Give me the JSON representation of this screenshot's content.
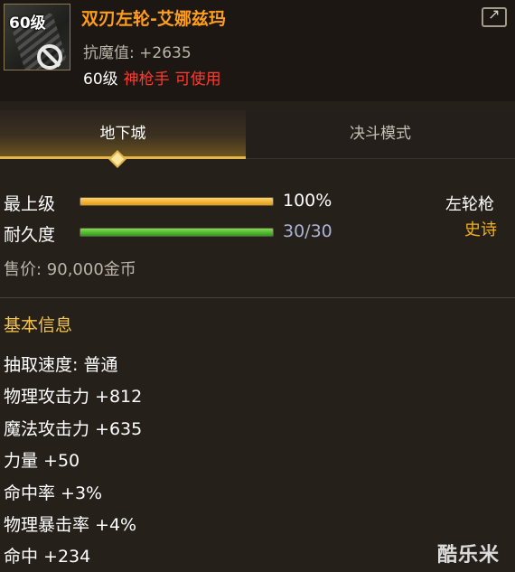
{
  "item": {
    "level_badge": "60级",
    "name": "双刃左轮-艾娜兹玛",
    "resist_text": "抗魔值: +2635",
    "req_level": "60级",
    "req_class": "神枪手",
    "req_usable": "可使用",
    "icon": "revolver-item-icon",
    "status_icon": "ban-icon"
  },
  "tabs": [
    {
      "label": "地下城",
      "active": true
    },
    {
      "label": "决斗模式",
      "active": false
    }
  ],
  "stats": {
    "upgrade_label": "最上级",
    "upgrade_value": "100%",
    "upgrade_fraction": 1.0,
    "durability_label": "耐久度",
    "durability_value": "30/30",
    "durability_fraction": 1.0,
    "weapon_type": "左轮枪",
    "rarity": "史诗",
    "price": "售价: 90,000金币"
  },
  "basic_info": {
    "title": "基本信息",
    "attributes": [
      "抽取速度: 普通",
      "物理攻击力 +812",
      "魔法攻击力 +635",
      "力量 +50",
      "命中率 +3%",
      "物理暴击率 +4%",
      "命中 +234"
    ]
  },
  "watermark": "酷乐米",
  "colors": {
    "item_name": "#ff9d1a",
    "class_req": "#ff3a2e",
    "rarity": "#f0b11e",
    "section_title": "#f5c44c",
    "tab_accent": "#e3b54a"
  }
}
